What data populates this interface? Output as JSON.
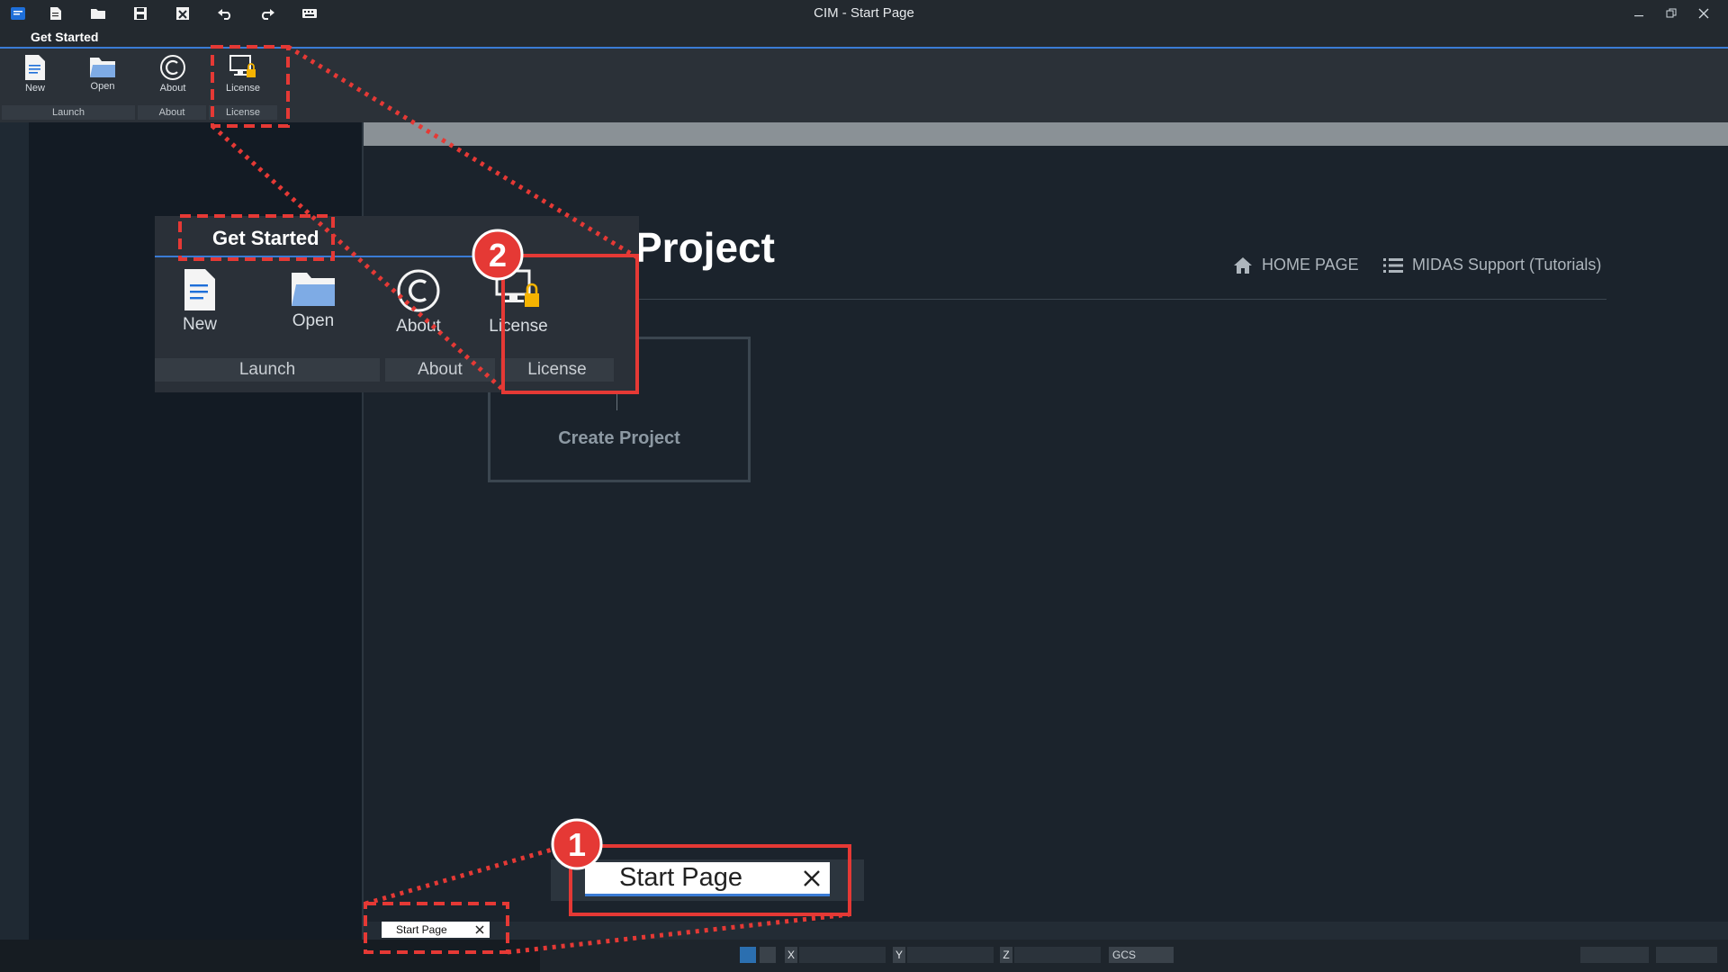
{
  "window": {
    "title": "CIM - Start Page"
  },
  "quick_access": {
    "icons": [
      "app-logo-icon",
      "new-file-icon",
      "open-folder-icon",
      "save-icon",
      "close-file-icon",
      "undo-icon",
      "redo-icon",
      "keyboard-icon"
    ]
  },
  "ribbon": {
    "tab": "Get Started",
    "buttons": {
      "new": "New",
      "open": "Open",
      "about": "About",
      "license": "License"
    },
    "groups": {
      "launch": "Launch",
      "about": "About",
      "license": "License"
    }
  },
  "start_page": {
    "title": "Project",
    "links": {
      "home": "HOME PAGE",
      "support": "MIDAS Support (Tutorials)"
    },
    "create_project": "Create Project"
  },
  "doc_tab": {
    "label": "Start Page"
  },
  "status_bar": {
    "x_label": "X",
    "y_label": "Y",
    "z_label": "Z",
    "coord_system": "GCS"
  },
  "annotations": {
    "badge_1": "1",
    "badge_2": "2",
    "accent_color": "#e53935"
  }
}
